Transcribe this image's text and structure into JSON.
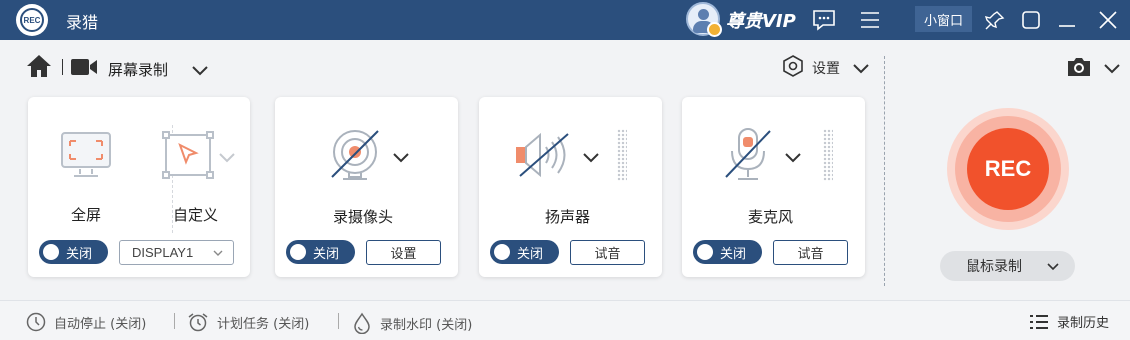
{
  "app": {
    "name": "录猎",
    "logo_text": "REC"
  },
  "titlebar": {
    "vip_label": "尊贵VIP",
    "mini_window_label": "小窗口",
    "icons": [
      "message-icon",
      "menu-icon",
      "pin-icon",
      "restore-icon",
      "minimize-icon",
      "close-icon"
    ]
  },
  "toolbar": {
    "mode_label": "屏幕录制",
    "settings_label": "设置"
  },
  "cards": {
    "screen": {
      "fullscreen_label": "全屏",
      "custom_label": "自定义",
      "toggle_label": "关闭",
      "display_value": "DISPLAY1"
    },
    "webcam": {
      "label": "录摄像头",
      "toggle_label": "关闭",
      "settings_button": "设置"
    },
    "speaker": {
      "label": "扬声器",
      "toggle_label": "关闭",
      "test_button": "试音"
    },
    "microphone": {
      "label": "麦克风",
      "toggle_label": "关闭",
      "test_button": "试音"
    }
  },
  "record": {
    "button_label": "REC",
    "mode_label": "鼠标录制"
  },
  "statusbar": {
    "auto_stop": "自动停止 (关闭)",
    "schedule": "计划任务 (关闭)",
    "watermark": "录制水印 (关闭)",
    "history": "录制历史"
  },
  "colors": {
    "titlebar": "#2b4f7d",
    "accent": "#2b4f7d",
    "rec": "#f1522c",
    "icon_muted": "#f08c6b"
  }
}
